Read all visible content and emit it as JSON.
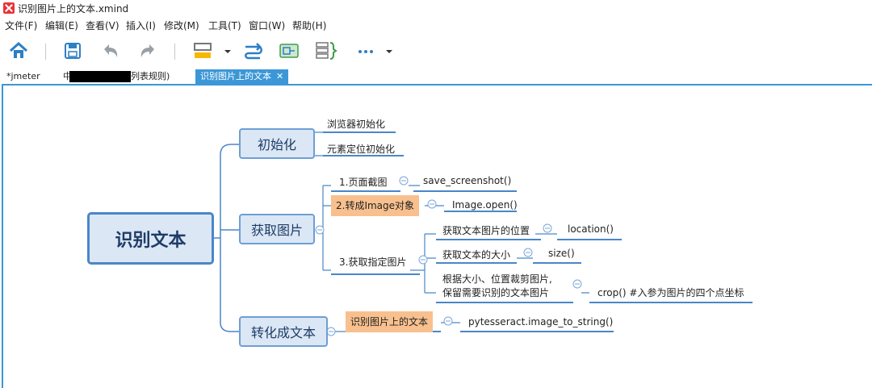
{
  "window": {
    "title": "识别图片上的文本.xmind"
  },
  "menu": [
    "文件(F)",
    "编辑(E)",
    "查看(V)",
    "插入(I)",
    "修改(M)",
    "工具(T)",
    "窗口(W)",
    "帮助(H)"
  ],
  "toolbar": {
    "icons": [
      "home-icon",
      "save-icon",
      "undo-icon",
      "redo-icon",
      "topic-style-icon",
      "relationship-icon",
      "boundary-icon",
      "summary-icon",
      "more-icon"
    ]
  },
  "tabs": [
    {
      "label": "*jmeter"
    },
    {
      "label": "中"
    },
    {
      "label": "列表规则)"
    },
    {
      "label": "识别图片上的文本",
      "close": "✕"
    }
  ],
  "mindmap": {
    "root": "识别文本",
    "b1": {
      "label": "初始化",
      "children": [
        "浏览器初始化",
        "元素定位初始化"
      ]
    },
    "b2": {
      "label": "获取图片",
      "s1": {
        "label": "1.页面截图",
        "child": "save_screenshot()"
      },
      "s2": {
        "label": "2.转成Image对象",
        "child": "Image.open()"
      },
      "s3": {
        "label": "3.获取指定图片",
        "c1": {
          "label": "获取文本图片的位置",
          "child": "location()"
        },
        "c2": {
          "label": "获取文本的大小",
          "child": "size()"
        },
        "c3": {
          "line1": "根据大小、位置裁剪图片,",
          "line2": "保留需要识别的文本图片",
          "child": "crop() #入参为图片的四个点坐标"
        }
      }
    },
    "b3": {
      "label": "转化成文本",
      "s1": {
        "label": "识别图片上的文本",
        "child": "pytesseract.image_to_string()"
      }
    },
    "collapse_symbol": "⊖"
  }
}
